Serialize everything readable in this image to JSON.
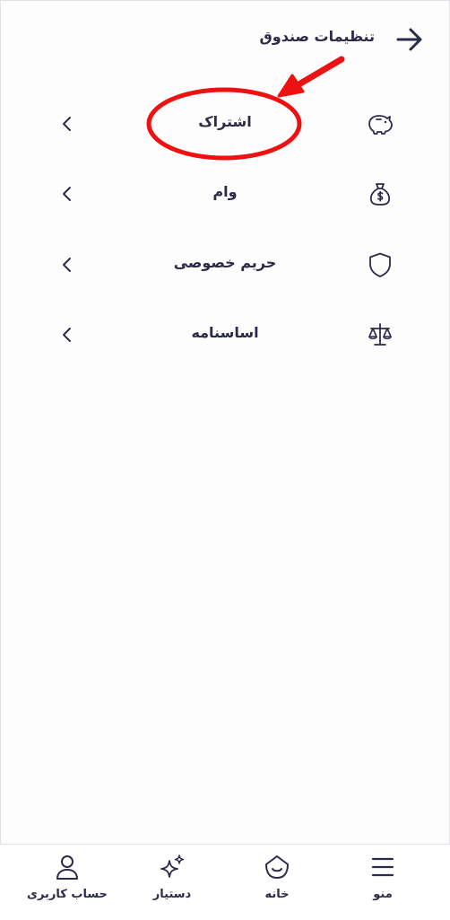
{
  "header": {
    "title": "تنظیمات صندوق",
    "back_icon": "arrow-right-icon"
  },
  "settings": [
    {
      "label": "اشتراک",
      "icon": "piggy-bank-icon"
    },
    {
      "label": "وام",
      "icon": "money-bag-icon"
    },
    {
      "label": "حریم خصوصی",
      "icon": "shield-icon"
    },
    {
      "label": "اساسنامه",
      "icon": "scales-icon"
    }
  ],
  "annotation": {
    "color": "#ee1111"
  },
  "bottom_nav": [
    {
      "label": "منو",
      "icon": "menu-icon"
    },
    {
      "label": "خانه",
      "icon": "home-icon"
    },
    {
      "label": "دستیار",
      "icon": "sparkle-icon"
    },
    {
      "label": "حساب کاربری",
      "icon": "user-icon"
    }
  ],
  "colors": {
    "text": "#2b2b4a",
    "border": "#e2e2e6",
    "background": "#fdfdfd"
  }
}
